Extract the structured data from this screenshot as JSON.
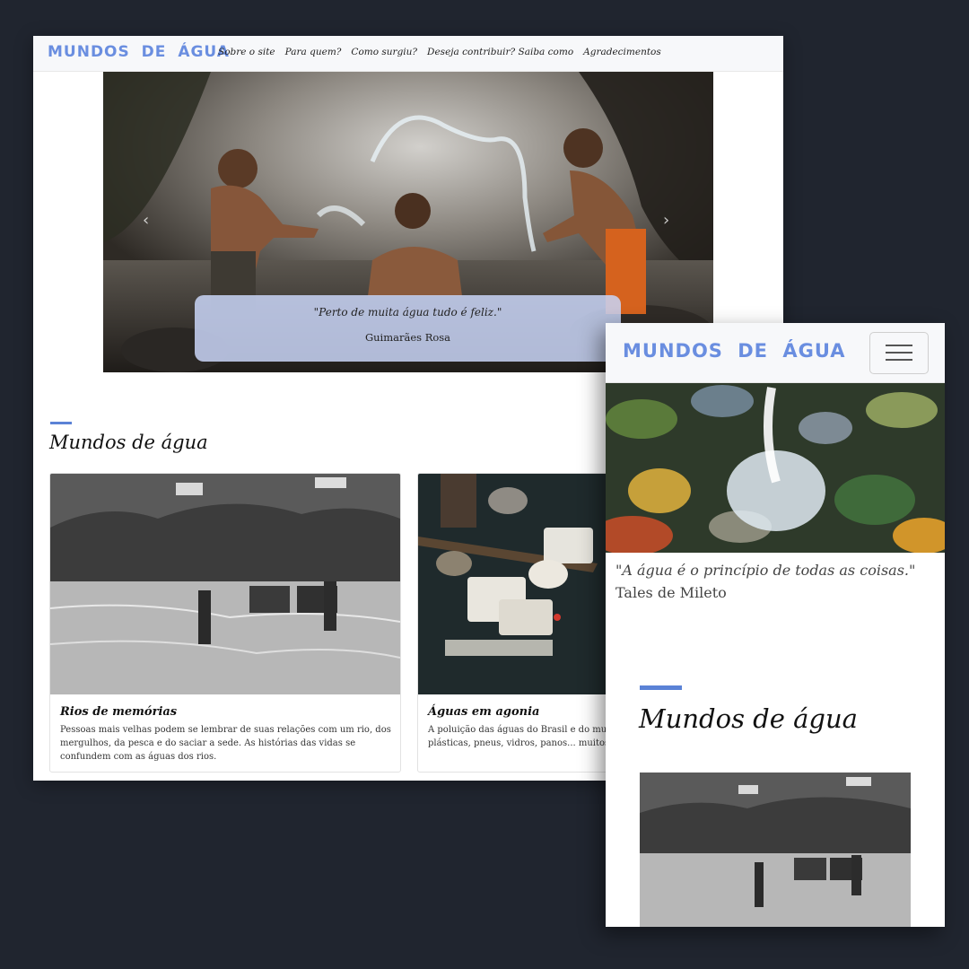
{
  "desktop": {
    "brand": "MUNDOS DE ÁGUA",
    "nav": [
      "Sobre o site",
      "Para quem?",
      "Como surgiu?",
      "Deseja contribuir? Saiba como",
      "Agradecimentos"
    ],
    "carousel": {
      "prev_icon": "‹",
      "next_icon": "›",
      "quote": "\"Perto de muita água tudo é feliz.\"",
      "author": "Guimarães Rosa"
    },
    "section_title": "Mundos de água",
    "cards": [
      {
        "title": "Rios de memórias",
        "text": "Pessoas mais velhas podem se lembrar de suas relações com um rio, dos mergulhos, da pesca e do saciar a sede. As histórias das vidas se confundem com as águas dos rios."
      },
      {
        "title": "Águas em agonia",
        "text": "A poluição das águas do Brasil e do mundo, águas cheias de garrafas plásticas, pneus, vidros, panos... muitos"
      }
    ]
  },
  "mobile": {
    "brand": "MUNDOS DE ÁGUA",
    "quote": "\"A água é o princípio de todas as coisas.\"",
    "author": "Tales de Mileto",
    "section_title": "Mundos de água"
  },
  "colors": {
    "background": "#20252f",
    "brand": "#6a8ee0",
    "accent": "#5b82d6",
    "caption_bg": "#c8d4f6"
  }
}
